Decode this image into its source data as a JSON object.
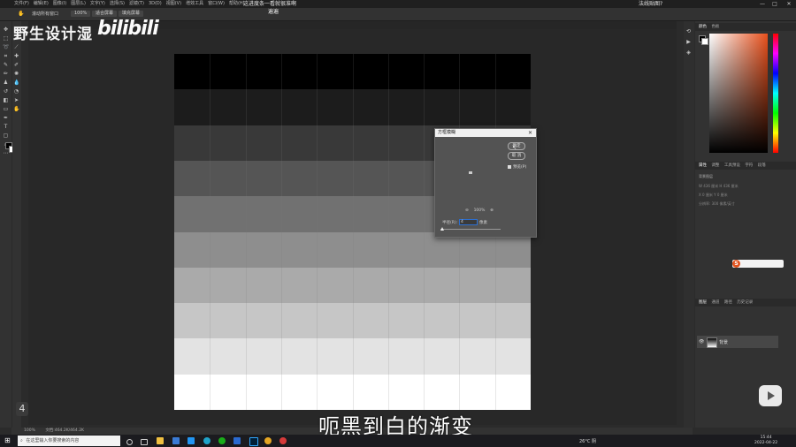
{
  "menubar": {
    "items": [
      "文件(F)",
      "编辑(E)",
      "图像(I)",
      "图层(L)",
      "文字(Y)",
      "选择(S)",
      "滤镜(T)",
      "3D(D)",
      "视图(V)",
      "增效工具",
      "窗口(W)",
      "帮助(H)"
    ]
  },
  "window": {
    "title": "这进度条一看就很准啊",
    "doc_banner": "遍遍",
    "help_text": "法线贴图?",
    "minimize": "—",
    "maximize": "□",
    "close": "✕"
  },
  "options": {
    "scroll_all": "滚动所有窗口",
    "zoom": "100%",
    "fit_screen": "适合屏幕",
    "fill_screen": "填充屏幕"
  },
  "watermark": {
    "text": "野生设计湿",
    "logo": "bilibili",
    "badge": "4"
  },
  "subtitle": "呃黑到白的渐变",
  "canvas": {
    "bands": [
      "#000000",
      "#1c1c1c",
      "#393939",
      "#555555",
      "#717171",
      "#8e8e8e",
      "#aaaaaa",
      "#c6c6c6",
      "#e3e3e3",
      "#ffffff"
    ],
    "columns": 10
  },
  "dialog": {
    "title": "方框模糊",
    "close": "✕",
    "ok": "确定",
    "cancel": "取 消",
    "preview_label": "预览(P)",
    "zoom_out": "⊖",
    "zoom_level": "100%",
    "zoom_in": "⊕",
    "radius_label": "半径(R):",
    "radius_value": "4",
    "radius_unit": "像素"
  },
  "right_panel": {
    "color_tabs": [
      "颜色",
      "色板"
    ],
    "props_tabs": [
      "属性",
      "调整",
      "工具预设",
      "字符",
      "段落"
    ],
    "props_title": "背景图层",
    "props_rows": [
      "W  436 厘米    H  436 厘米",
      "X  0 厘米      Y  0 厘米",
      "分辨率: 300 像素/英寸"
    ],
    "layers_tabs": [
      "图层",
      "通道",
      "路径",
      "历史记录"
    ],
    "layer_name": "背景"
  },
  "statusbar": {
    "zoom": "100%",
    "doc": "文档:464.2K/464.2K"
  },
  "taskbar": {
    "search_placeholder": "在这里输入你要搜索的内容",
    "weather": "26°C 阴",
    "time": "15:44",
    "date": "2022-04-22"
  },
  "colors": {
    "accent_orange": "#e8501c",
    "dialog_bg": "#535353",
    "app_bg": "#2b2b2b"
  }
}
